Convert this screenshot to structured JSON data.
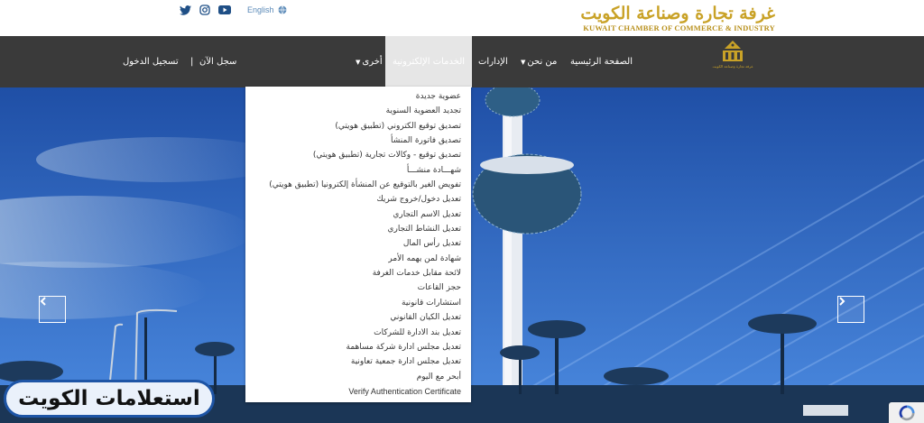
{
  "header": {
    "brand_ar": "غرفة تجارة وصناعة الكويت",
    "brand_en": "KUWAIT CHAMBER OF COMMERCE & INDUSTRY",
    "language_label": "English",
    "social_icons": [
      "twitter-icon",
      "instagram-icon",
      "youtube-icon"
    ],
    "brand_color": "#c9a227"
  },
  "nav": {
    "home": "الصفحة الرئيسية",
    "about": "من نحن",
    "departments": "الإدارات",
    "eservices": "الخدمات الإلكترونية",
    "other": "أخرى",
    "register": "سجل الآن",
    "separator": "|",
    "login": "تسجيل الدخول",
    "logo_caption": "غرفة تجارة وصناعة الكويت"
  },
  "dropdown": {
    "items": [
      "عضوية جديدة",
      "تجديد العضوية السنوية",
      "تصديق توقيع الكتروني (تطبيق هويتي)",
      "تصديق فاتورة المنشأ",
      "تصديق توقيع - وكالات تجارية (تطبيق هويتي)",
      "شهـــادة منشـــأ",
      "تفويض الغير بالتوقيع عن المنشأة إلكترونيا (تطبيق هويتي)",
      "تعديل دخول/خروج شريك",
      "تعديل الاسم التجاري",
      "تعديل النشاط التجاري",
      "تعديل رأس المال",
      "شهادة لمن يهمه الأمر",
      "لائحة مقابل خدمات الغرفة",
      "حجز القاعات",
      "استشارات قانونية",
      "تعديل الكيان القانوني",
      "تعديل بند الادارة للشركات",
      "تعديل مجلس ادارة شركة مساهمة",
      "تعديل مجلس ادارة جمعية تعاونية",
      "أبحر مع اليوم",
      "Verify Authentication Certificate"
    ]
  },
  "watermark": {
    "text": "استعلامات الكويت",
    "accent": "#1e55a6"
  }
}
